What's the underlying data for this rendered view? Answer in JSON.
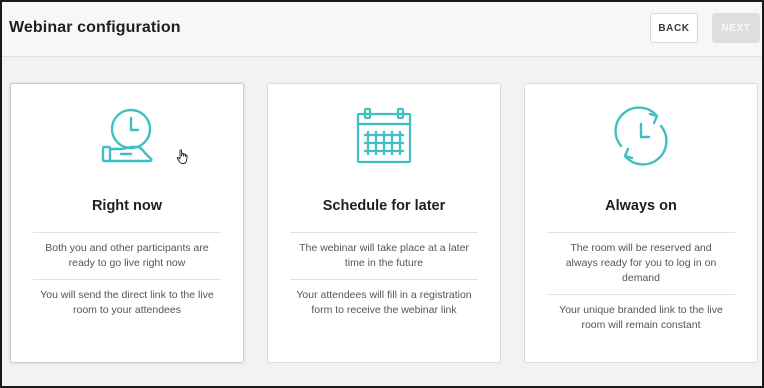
{
  "header": {
    "title": "Webinar configuration",
    "back_label": "BACK",
    "next_label": "NEXT"
  },
  "colors": {
    "accent": "#3fbfc4",
    "next_disabled_bg": "#dedede"
  },
  "options": [
    {
      "icon": "clock-hand-icon",
      "title": "Right now",
      "desc1": "Both you and other participants are ready to go live right now",
      "desc2": "You will send the direct link to the live room to your attendees"
    },
    {
      "icon": "calendar-icon",
      "title": "Schedule for later",
      "desc1": "The webinar will take place at a later time in the future",
      "desc2": "Your attendees will fill in a registration form to receive the webinar link"
    },
    {
      "icon": "clock-cycle-icon",
      "title": "Always on",
      "desc1": "The room will be reserved and always ready for you to log in on demand",
      "desc2": "Your unique branded link to the live room will remain constant"
    }
  ]
}
